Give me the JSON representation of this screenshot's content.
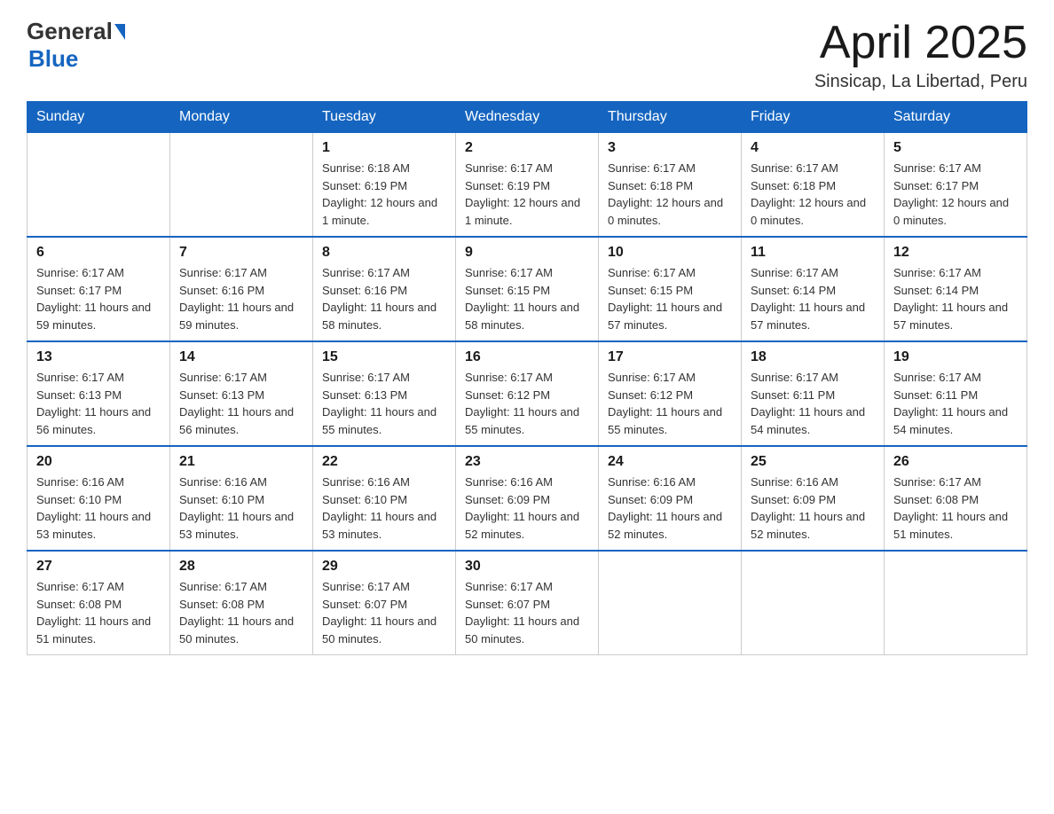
{
  "header": {
    "logo": {
      "general": "General",
      "blue": "Blue"
    },
    "title": "April 2025",
    "location": "Sinsicap, La Libertad, Peru"
  },
  "days_of_week": [
    "Sunday",
    "Monday",
    "Tuesday",
    "Wednesday",
    "Thursday",
    "Friday",
    "Saturday"
  ],
  "weeks": [
    [
      {
        "day": "",
        "info": ""
      },
      {
        "day": "",
        "info": ""
      },
      {
        "day": "1",
        "info": "Sunrise: 6:18 AM\nSunset: 6:19 PM\nDaylight: 12 hours and 1 minute."
      },
      {
        "day": "2",
        "info": "Sunrise: 6:17 AM\nSunset: 6:19 PM\nDaylight: 12 hours and 1 minute."
      },
      {
        "day": "3",
        "info": "Sunrise: 6:17 AM\nSunset: 6:18 PM\nDaylight: 12 hours and 0 minutes."
      },
      {
        "day": "4",
        "info": "Sunrise: 6:17 AM\nSunset: 6:18 PM\nDaylight: 12 hours and 0 minutes."
      },
      {
        "day": "5",
        "info": "Sunrise: 6:17 AM\nSunset: 6:17 PM\nDaylight: 12 hours and 0 minutes."
      }
    ],
    [
      {
        "day": "6",
        "info": "Sunrise: 6:17 AM\nSunset: 6:17 PM\nDaylight: 11 hours and 59 minutes."
      },
      {
        "day": "7",
        "info": "Sunrise: 6:17 AM\nSunset: 6:16 PM\nDaylight: 11 hours and 59 minutes."
      },
      {
        "day": "8",
        "info": "Sunrise: 6:17 AM\nSunset: 6:16 PM\nDaylight: 11 hours and 58 minutes."
      },
      {
        "day": "9",
        "info": "Sunrise: 6:17 AM\nSunset: 6:15 PM\nDaylight: 11 hours and 58 minutes."
      },
      {
        "day": "10",
        "info": "Sunrise: 6:17 AM\nSunset: 6:15 PM\nDaylight: 11 hours and 57 minutes."
      },
      {
        "day": "11",
        "info": "Sunrise: 6:17 AM\nSunset: 6:14 PM\nDaylight: 11 hours and 57 minutes."
      },
      {
        "day": "12",
        "info": "Sunrise: 6:17 AM\nSunset: 6:14 PM\nDaylight: 11 hours and 57 minutes."
      }
    ],
    [
      {
        "day": "13",
        "info": "Sunrise: 6:17 AM\nSunset: 6:13 PM\nDaylight: 11 hours and 56 minutes."
      },
      {
        "day": "14",
        "info": "Sunrise: 6:17 AM\nSunset: 6:13 PM\nDaylight: 11 hours and 56 minutes."
      },
      {
        "day": "15",
        "info": "Sunrise: 6:17 AM\nSunset: 6:13 PM\nDaylight: 11 hours and 55 minutes."
      },
      {
        "day": "16",
        "info": "Sunrise: 6:17 AM\nSunset: 6:12 PM\nDaylight: 11 hours and 55 minutes."
      },
      {
        "day": "17",
        "info": "Sunrise: 6:17 AM\nSunset: 6:12 PM\nDaylight: 11 hours and 55 minutes."
      },
      {
        "day": "18",
        "info": "Sunrise: 6:17 AM\nSunset: 6:11 PM\nDaylight: 11 hours and 54 minutes."
      },
      {
        "day": "19",
        "info": "Sunrise: 6:17 AM\nSunset: 6:11 PM\nDaylight: 11 hours and 54 minutes."
      }
    ],
    [
      {
        "day": "20",
        "info": "Sunrise: 6:16 AM\nSunset: 6:10 PM\nDaylight: 11 hours and 53 minutes."
      },
      {
        "day": "21",
        "info": "Sunrise: 6:16 AM\nSunset: 6:10 PM\nDaylight: 11 hours and 53 minutes."
      },
      {
        "day": "22",
        "info": "Sunrise: 6:16 AM\nSunset: 6:10 PM\nDaylight: 11 hours and 53 minutes."
      },
      {
        "day": "23",
        "info": "Sunrise: 6:16 AM\nSunset: 6:09 PM\nDaylight: 11 hours and 52 minutes."
      },
      {
        "day": "24",
        "info": "Sunrise: 6:16 AM\nSunset: 6:09 PM\nDaylight: 11 hours and 52 minutes."
      },
      {
        "day": "25",
        "info": "Sunrise: 6:16 AM\nSunset: 6:09 PM\nDaylight: 11 hours and 52 minutes."
      },
      {
        "day": "26",
        "info": "Sunrise: 6:17 AM\nSunset: 6:08 PM\nDaylight: 11 hours and 51 minutes."
      }
    ],
    [
      {
        "day": "27",
        "info": "Sunrise: 6:17 AM\nSunset: 6:08 PM\nDaylight: 11 hours and 51 minutes."
      },
      {
        "day": "28",
        "info": "Sunrise: 6:17 AM\nSunset: 6:08 PM\nDaylight: 11 hours and 50 minutes."
      },
      {
        "day": "29",
        "info": "Sunrise: 6:17 AM\nSunset: 6:07 PM\nDaylight: 11 hours and 50 minutes."
      },
      {
        "day": "30",
        "info": "Sunrise: 6:17 AM\nSunset: 6:07 PM\nDaylight: 11 hours and 50 minutes."
      },
      {
        "day": "",
        "info": ""
      },
      {
        "day": "",
        "info": ""
      },
      {
        "day": "",
        "info": ""
      }
    ]
  ]
}
